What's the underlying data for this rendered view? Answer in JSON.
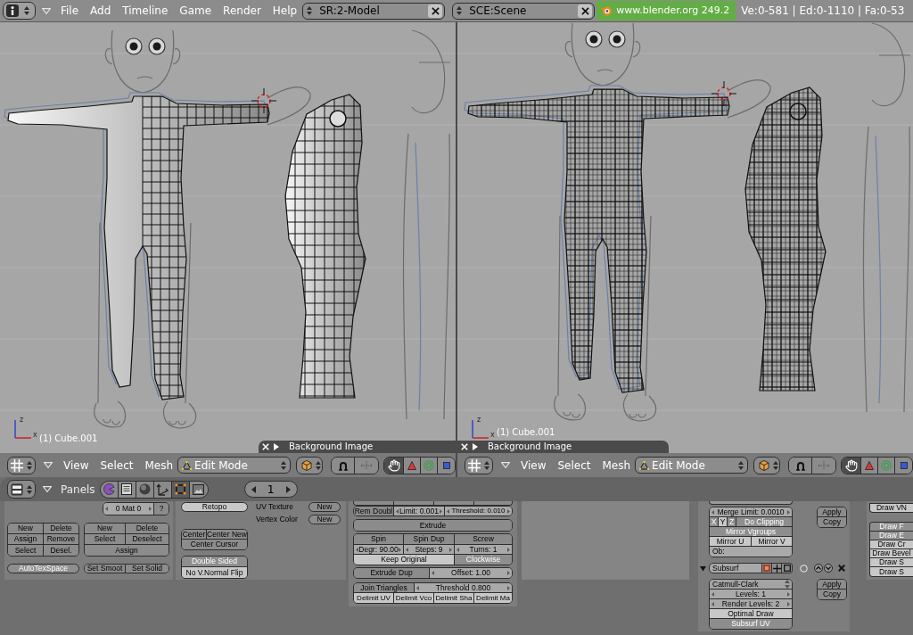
{
  "top_bar": {
    "menus": [
      "File",
      "Add",
      "Timeline",
      "Game",
      "Render",
      "Help"
    ],
    "screen": "SR:2-Model",
    "scene": "SCE:Scene",
    "version": "www.blender.org 249.2",
    "stats": "Ve:0-581 | Ed:0-1110 | Fa:0-53"
  },
  "viewports": [
    {
      "wireframe": false,
      "object": "(1) Cube.001",
      "axes": [
        "z",
        "x"
      ],
      "panel": "Background Image",
      "menus": [
        "View",
        "Select",
        "Mesh"
      ],
      "mode": "Edit Mode",
      "tools": [
        {
          "kind": "hand",
          "selected": true
        },
        {
          "kind": "translate",
          "selected": false
        },
        {
          "kind": "rotate",
          "selected": false
        },
        {
          "kind": "scale",
          "selected": false
        }
      ]
    },
    {
      "wireframe": true,
      "object": "(1) Cube.001",
      "axes": [
        "z",
        "x"
      ],
      "panel": "Background Image",
      "menus": [
        "View",
        "Select",
        "Mesh"
      ],
      "mode": "Edit Mode",
      "tools": [
        {
          "kind": "hand",
          "selected": true
        },
        {
          "kind": "translate",
          "selected": false
        },
        {
          "kind": "rotate",
          "selected": false
        },
        {
          "kind": "scale",
          "selected": false
        }
      ]
    }
  ],
  "buttons_window": {
    "title": "Panels",
    "tabs": [
      {
        "kind": "logic",
        "selected": false
      },
      {
        "kind": "script",
        "selected": false
      },
      {
        "kind": "shading",
        "selected": false
      },
      {
        "kind": "object",
        "selected": false
      },
      {
        "kind": "editing",
        "selected": true
      },
      {
        "kind": "scene",
        "selected": false
      }
    ],
    "frame": "1"
  },
  "link_and_materials": {
    "material": "0 Mat 0",
    "help": "?",
    "vertex_groups": [
      [
        "New",
        "Delete"
      ],
      [
        "Assign",
        "Remove"
      ],
      [
        "Select",
        "Desel."
      ]
    ],
    "materials": [
      [
        "New",
        "Delete"
      ],
      [
        "Select",
        "Deselect"
      ],
      [
        "Assign"
      ]
    ],
    "auto_tex_space": {
      "label": "AutoTexSpace",
      "on": true
    },
    "shading": [
      "Set Smoot",
      "Set Solid"
    ]
  },
  "mesh": {
    "retopo": {
      "label": "Retopo",
      "on": false
    },
    "layers": [
      {
        "label": "UV Texture",
        "button": "New"
      },
      {
        "label": "Vertex Color",
        "button": "New"
      }
    ],
    "center": [
      "Center",
      "Center New",
      "Center Cursor"
    ],
    "toggles": [
      {
        "label": "Double Sided",
        "on": true
      },
      {
        "label": "No V.Normal Flip",
        "on": false
      }
    ]
  },
  "mesh_tools": {
    "groups": [
      [
        [
          {
            "label": "Rem Doubl",
            "kind": "push"
          },
          {
            "label": "Limit: 0.001",
            "kind": "number"
          },
          {
            "label": "Threshold: 0.010",
            "kind": "number"
          }
        ]
      ],
      [
        [
          {
            "label": "Extrude",
            "kind": "push"
          }
        ]
      ],
      [
        [
          {
            "label": "Spin",
            "kind": "push"
          },
          {
            "label": "Spin Dup",
            "kind": "push"
          },
          {
            "label": "Screw",
            "kind": "push"
          }
        ],
        [
          {
            "label": "Degr: 90.00",
            "kind": "number"
          },
          {
            "label": "Steps: 9",
            "kind": "number"
          },
          {
            "label": "Turns: 1",
            "kind": "number"
          }
        ],
        [
          {
            "label": "Keep Original",
            "kind": "toggle",
            "on": false
          },
          {
            "label": "Clockwise",
            "kind": "toggle",
            "on": true
          }
        ]
      ],
      [
        [
          {
            "label": "Extrude Dup",
            "kind": "push"
          },
          {
            "label": "Offset: 1.00",
            "kind": "number"
          }
        ]
      ],
      [
        [
          {
            "label": "Join Triangles",
            "kind": "push"
          },
          {
            "label": "Threshold 0.800",
            "kind": "number"
          }
        ],
        [
          {
            "label": "Delimit UV",
            "kind": "toggle",
            "on": false
          },
          {
            "label": "Delimit Vco",
            "kind": "toggle",
            "on": false
          },
          {
            "label": "Delimit Sha",
            "kind": "toggle",
            "on": false
          },
          {
            "label": "Delimit Ma",
            "kind": "toggle",
            "on": false
          }
        ]
      ]
    ]
  },
  "modifiers": [
    {
      "kind": "mirror",
      "merge_limit": "Merge Limit: 0.0010",
      "axes": [
        {
          "label": "X",
          "on": true
        },
        {
          "label": "Y",
          "on": false
        },
        {
          "label": "Z",
          "on": true
        }
      ],
      "clipping": {
        "label": "Do Clipping",
        "on": true
      },
      "vgroups": {
        "label": "Mirror Vgroups",
        "on": true
      },
      "uv": [
        {
          "label": "Mirror U",
          "on": false
        },
        {
          "label": "Mirror V",
          "on": false
        }
      ],
      "object": "Ob:",
      "actions": [
        "Apply",
        "Copy"
      ]
    },
    {
      "kind": "subsurf",
      "expanded": true,
      "name": "Subsurf",
      "type": "Catmull-Clark",
      "levels": "Levels: 1",
      "render_levels": "Render Levels: 2",
      "toggles": [
        {
          "label": "Optimal Draw",
          "on": false
        },
        {
          "label": "Subsurf UV",
          "on": true
        }
      ],
      "actions": [
        "Apply",
        "Copy"
      ]
    }
  ],
  "draw_options": [
    {
      "label": "Draw VN",
      "on": false
    },
    {
      "label": "Draw F",
      "on": true
    },
    {
      "label": "Draw E",
      "on": true
    },
    {
      "label": "Draw Cr",
      "on": false
    },
    {
      "label": "Draw Bevel",
      "on": false
    },
    {
      "label": "Draw S",
      "on": false
    },
    {
      "label": "Draw S",
      "on": false
    }
  ]
}
